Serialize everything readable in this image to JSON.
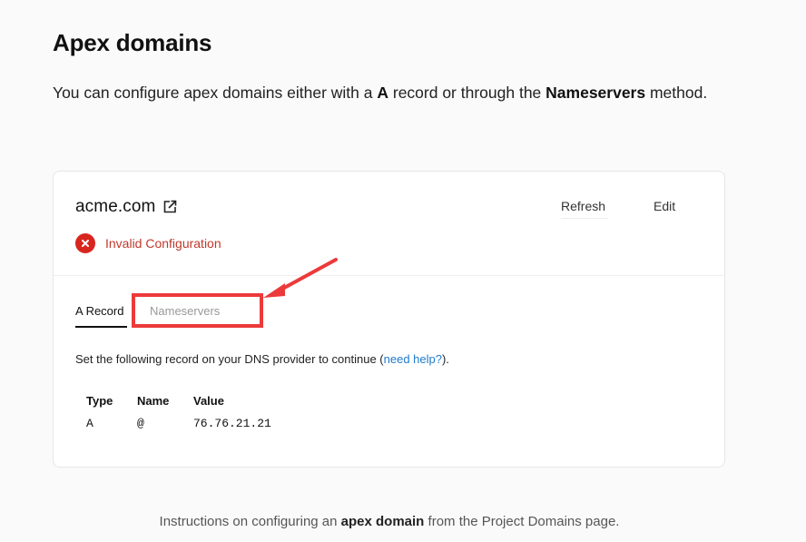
{
  "heading": "Apex domains",
  "intro": {
    "part1": "You can configure apex domains either with a ",
    "bold1": "A",
    "part2": " record or through the ",
    "bold2": "Nameservers",
    "part3": " method."
  },
  "card": {
    "domain": "acme.com",
    "status": "Invalid Configuration",
    "actions": {
      "refresh": "Refresh",
      "edit": "Edit"
    },
    "tabs": [
      {
        "label": "A Record",
        "active": true
      },
      {
        "label": "Nameservers",
        "active": false
      }
    ],
    "instruction": {
      "before": "Set the following record on your DNS provider to continue (",
      "link": "need help?",
      "after": ")."
    },
    "record_table": {
      "headers": [
        "Type",
        "Name",
        "Value"
      ],
      "rows": [
        [
          "A",
          "@",
          "76.76.21.21"
        ]
      ]
    }
  },
  "caption": {
    "before": "Instructions on configuring an ",
    "bold": "apex domain",
    "after": " from the Project Domains page."
  },
  "colors": {
    "error": "#d8261f",
    "error_text": "#c0392b",
    "link": "#1f7acc",
    "annotation": "#ec3a3a"
  }
}
